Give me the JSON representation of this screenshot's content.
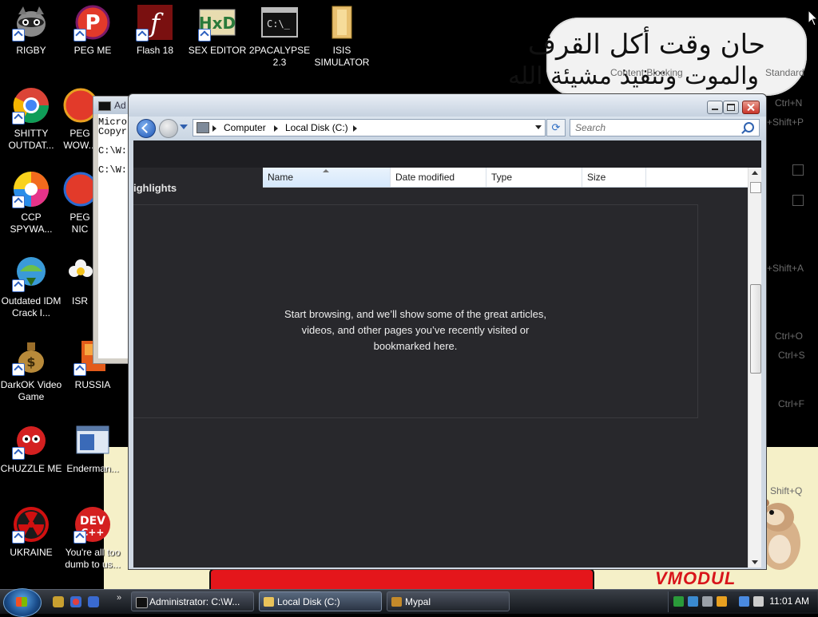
{
  "desktop": {
    "icons": [
      {
        "label": "RIGBY",
        "color": "#7a6a5e"
      },
      {
        "label": "PEG ME",
        "color": "#e23a2a"
      },
      {
        "label": "Flash 18",
        "color": "#7a1010"
      },
      {
        "label": "SEX EDITOR",
        "color": "#c9b86a"
      },
      {
        "label": "2PACALYPSE 2.3",
        "color": "#222222"
      },
      {
        "label": "ISIS SIMULATOR",
        "color": "#e8c070"
      },
      {
        "label": "SHITTY OUTDAT...",
        "color": "#2f9e44"
      },
      {
        "label": "PEG WOW...",
        "color": "#e23a2a"
      },
      {
        "label": "CCP SPYWA...",
        "color": "#f2a21b"
      },
      {
        "label": "PEG NIC",
        "color": "#e23a2a"
      },
      {
        "label": "Outdated IDM Crack I...",
        "color": "#3a9a3a"
      },
      {
        "label": "ISR",
        "color": "#f4f4f4"
      },
      {
        "label": "DarkOK Video Game",
        "color": "#b88a3a"
      },
      {
        "label": "RUSSIA",
        "color": "#e35b1a"
      },
      {
        "label": "CHUZZLE ME",
        "color": "#d42020"
      },
      {
        "label": "Enderman...",
        "color": "#dfe8f4"
      },
      {
        "label": "UKRAINE",
        "color": "#d01010"
      },
      {
        "label": "You're all too dumb to us...",
        "color": "#d42020"
      }
    ],
    "speech_bubble": {
      "line1": "حان وقت أكل القرف",
      "line2": "والموت وتنفيذ مشيئة الله"
    },
    "ghost_text": {
      "content_blocking": "Content Blocking",
      "standard": "Standard",
      "ctrl_n": "Ctrl+N",
      "shift_p": "+Shift+P",
      "shift_a": "+Shift+A",
      "ctrl_o": "Ctrl+O",
      "ctrl_s": "Ctrl+S",
      "ctrl_f": "Ctrl+F",
      "shift_q": "Shift+Q"
    },
    "wallpaper_text": "VMODUL"
  },
  "cmd_window": {
    "title": "Ad",
    "lines": [
      "Micro",
      "Copyr",
      "",
      "C:\\W:",
      "",
      "C:\\W:"
    ]
  },
  "explorer": {
    "breadcrumb": [
      "Computer",
      "Local Disk (C:)"
    ],
    "search_placeholder": "Search",
    "highlights_label": "ighlights",
    "columns": [
      "Name",
      "Date modified",
      "Type",
      "Size"
    ],
    "empty_message": [
      "Start browsing, and we’ll show some of the great articles,",
      "videos, and other pages you’ve recently visited or",
      "bookmarked here."
    ]
  },
  "taskbar": {
    "tasks": [
      {
        "label": "Administrator: C:\\W...",
        "icon_color": "#111111"
      },
      {
        "label": "Local Disk (C:)",
        "icon_color": "#e9c35a"
      },
      {
        "label": "Mypal",
        "icon_color": "#c48a2a"
      }
    ],
    "more_glyph": "»",
    "clock": "11:01 AM"
  }
}
